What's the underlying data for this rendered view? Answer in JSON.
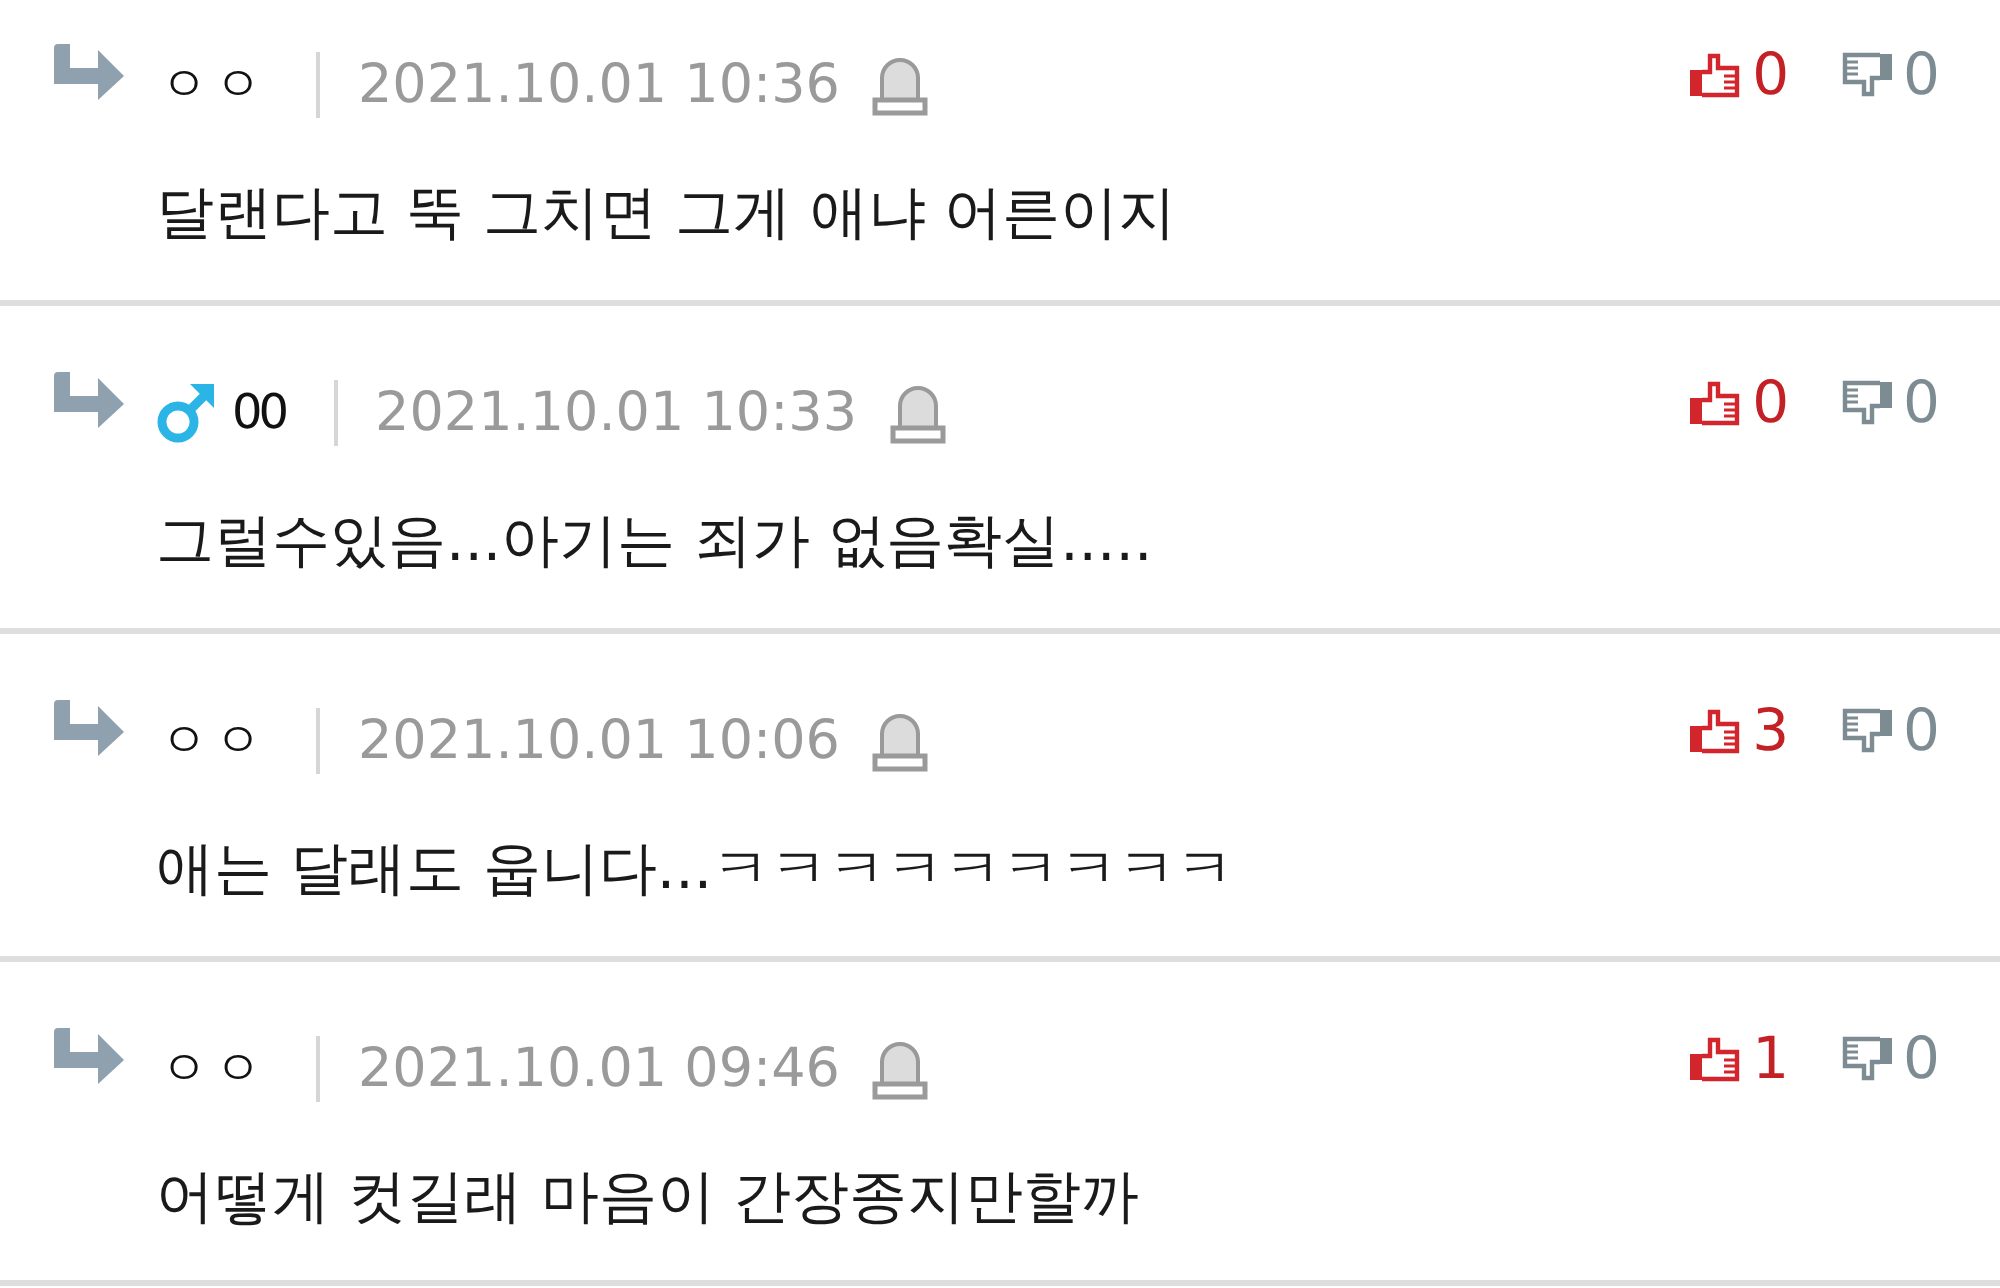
{
  "comments": [
    {
      "author": "ㅇㅇ",
      "male_icon": false,
      "date": "2021.10.01 10:36",
      "text": "달랜다고 뚝 그치면 그게 애냐 어른이지",
      "likes": "0",
      "dislikes": "0"
    },
    {
      "author": "00",
      "male_icon": true,
      "date": "2021.10.01 10:33",
      "text": "그럴수있음...아기는 죄가 없음확실.....",
      "likes": "0",
      "dislikes": "0"
    },
    {
      "author": "ㅇㅇ",
      "male_icon": false,
      "date": "2021.10.01 10:06",
      "text": "애는 달래도 웁니다...ㅋㅋㅋㅋㅋㅋㅋㅋㅋ",
      "likes": "3",
      "dislikes": "0"
    },
    {
      "author": "ㅇㅇ",
      "male_icon": false,
      "date": "2021.10.01 09:46",
      "text": "어떻게 컷길래 마음이 간장종지만할까",
      "likes": "1",
      "dislikes": "0"
    }
  ]
}
